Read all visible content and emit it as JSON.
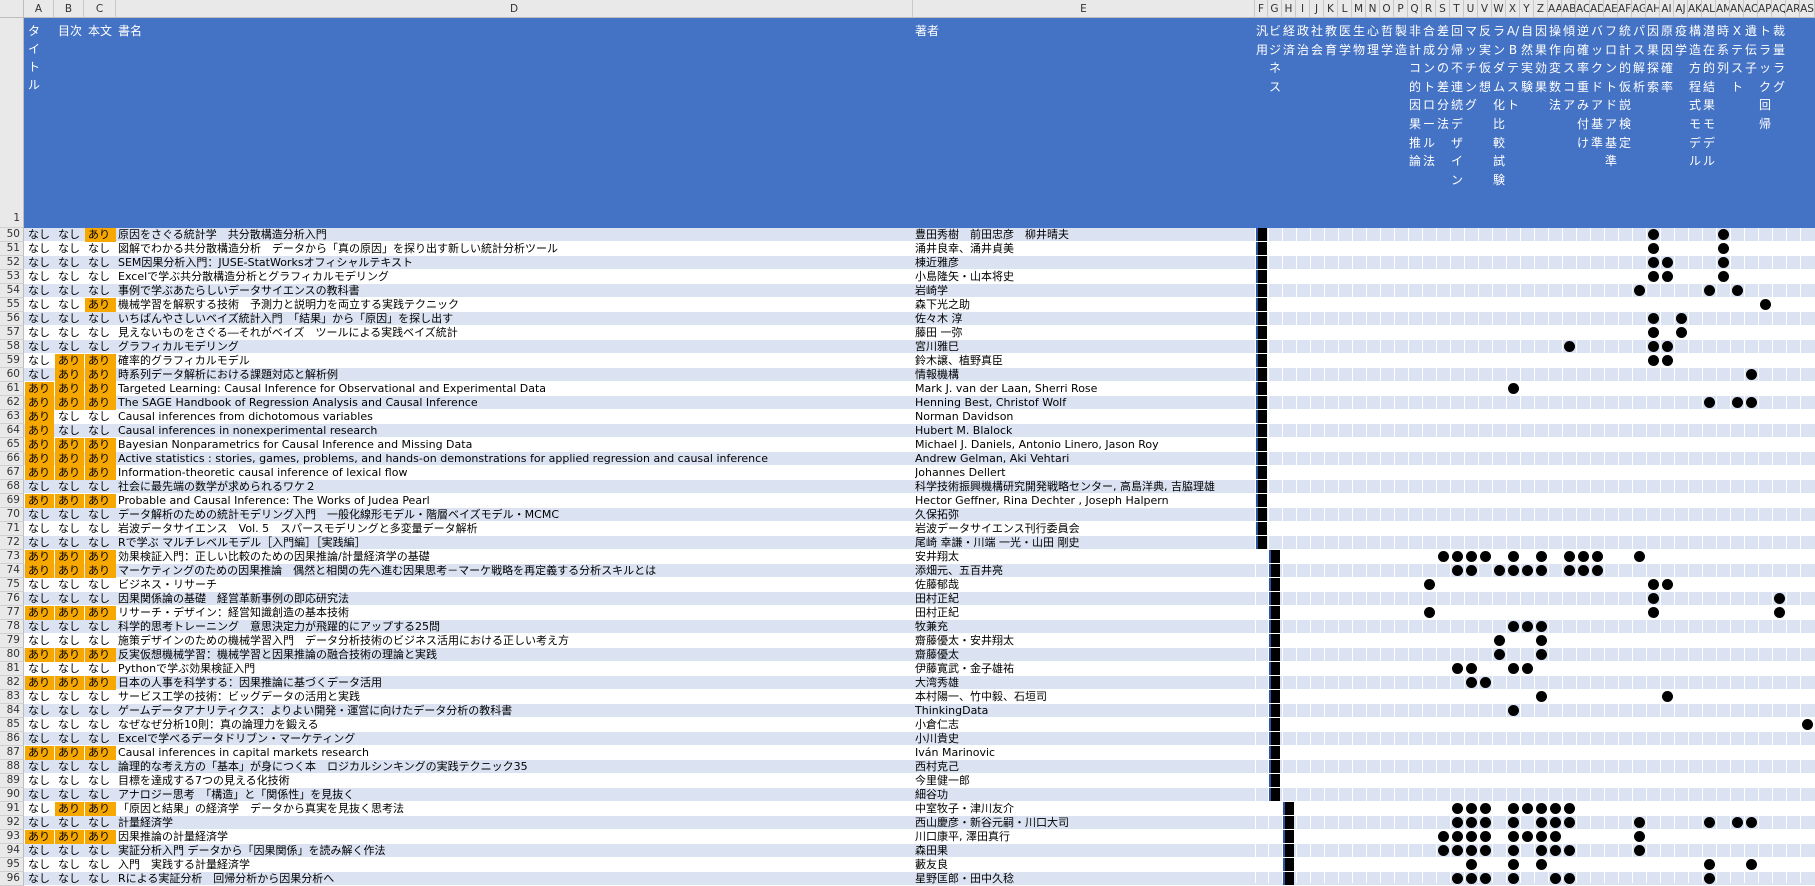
{
  "column_letters": [
    "A",
    "B",
    "C",
    "D",
    "E",
    "F",
    "G",
    "H",
    "I",
    "J",
    "K",
    "L",
    "M",
    "N",
    "O",
    "P",
    "Q",
    "R",
    "S",
    "T",
    "U",
    "V",
    "W",
    "X",
    "Y",
    "Z",
    "AA",
    "AB",
    "AC",
    "AD",
    "AE",
    "AF",
    "AG",
    "AH",
    "AI",
    "AJ",
    "AK",
    "AL",
    "AM",
    "AN",
    "AO",
    "AP",
    "AQ",
    "AR",
    "AS"
  ],
  "header_row_number": "1",
  "header": {
    "title_flag": "タイトル",
    "toc_flag": "目次",
    "body_flag": "本文",
    "book_title": "書名",
    "author": "著者",
    "topics": [
      "汎用",
      "ビジネス",
      "経済",
      "政治",
      "社会",
      "教育",
      "医学",
      "生物",
      "心理",
      "哲学",
      "製造",
      "非計コ的因果推論",
      "合成ントロール法",
      "差分の差分法",
      "回帰不連続デザイン",
      "マッチング",
      "反実仮想",
      "ランダム化比較試験",
      "A/Bテスト",
      "自然実験",
      "因果効果",
      "操作変数法",
      "傾向スコア",
      "逆確率重み付け",
      "バックドア基準",
      "フロントドア基準",
      "統計的仮説検定",
      "パス解析",
      "因果探索",
      "原因確率",
      "疫学",
      "構造方程式モデル",
      "潜在的結果モデル",
      "時系列",
      "Xテスト",
      "遺伝子",
      "トラック回帰",
      "裁量ラグ"
    ]
  },
  "rows": [
    {
      "n": "50",
      "a": "なし",
      "b": "なし",
      "c": "あり",
      "title": "原因をさぐる統計学　共分散構造分析入門",
      "author": "豊田秀樹　前田忠彦　柳井晴夫"
    },
    {
      "n": "51",
      "a": "なし",
      "b": "なし",
      "c": "なし",
      "title": "図解でわかる共分散構造分析　データから「真の原因」を探り出す新しい統計分析ツール",
      "author": "涌井良幸、涌井貞美"
    },
    {
      "n": "52",
      "a": "なし",
      "b": "なし",
      "c": "なし",
      "title": "SEM因果分析入門：JUSE-StatWorksオフィシャルテキスト",
      "author": "棟近雅彦"
    },
    {
      "n": "53",
      "a": "なし",
      "b": "なし",
      "c": "なし",
      "title": "Excelで学ぶ共分散構造分析とグラフィカルモデリング",
      "author": "小島隆矢・山本将史"
    },
    {
      "n": "54",
      "a": "なし",
      "b": "なし",
      "c": "なし",
      "title": "事例で学ぶあたらしいデータサイエンスの教科書",
      "author": "岩崎学"
    },
    {
      "n": "55",
      "a": "なし",
      "b": "なし",
      "c": "あり",
      "title": "機械学習を解釈する技術　予測力と説明力を両立する実践テクニック",
      "author": "森下光之助"
    },
    {
      "n": "56",
      "a": "なし",
      "b": "なし",
      "c": "なし",
      "title": "いちばんやさしいベイズ統計入門　「結果」から「原因」を探し出す",
      "author": "佐々木 淳"
    },
    {
      "n": "57",
      "a": "なし",
      "b": "なし",
      "c": "なし",
      "title": "見えないものをさぐる―それがベイズ　ツールによる実践ベイズ統計",
      "author": "藤田 一弥"
    },
    {
      "n": "58",
      "a": "なし",
      "b": "なし",
      "c": "なし",
      "title": "グラフィカルモデリング",
      "author": "宮川雅巳"
    },
    {
      "n": "59",
      "a": "なし",
      "b": "あり",
      "c": "あり",
      "title": "確率的グラフィカルモデル",
      "author": "鈴木譲、植野真臣"
    },
    {
      "n": "60",
      "a": "なし",
      "b": "あり",
      "c": "あり",
      "title": "時系列データ解析における課題対応と解析例",
      "author": "情報機構"
    },
    {
      "n": "61",
      "a": "あり",
      "b": "あり",
      "c": "あり",
      "title": "Targeted Learning: Causal Inference for Observational and Experimental Data",
      "author": "Mark J. van der Laan, Sherri Rose"
    },
    {
      "n": "62",
      "a": "あり",
      "b": "あり",
      "c": "あり",
      "title": "The SAGE Handbook of Regression Analysis and Causal Inference",
      "author": "Henning Best, Christof Wolf"
    },
    {
      "n": "63",
      "a": "あり",
      "b": "なし",
      "c": "なし",
      "title": "Causal inferences from dichotomous variables",
      "author": "Norman Davidson"
    },
    {
      "n": "64",
      "a": "あり",
      "b": "なし",
      "c": "なし",
      "title": "Causal inferences in nonexperimental research",
      "author": "Hubert M. Blalock"
    },
    {
      "n": "65",
      "a": "あり",
      "b": "あり",
      "c": "あり",
      "title": "Bayesian Nonparametrics for Causal Inference and Missing Data",
      "author": "Michael J. Daniels, Antonio Linero, Jason Roy"
    },
    {
      "n": "66",
      "a": "あり",
      "b": "あり",
      "c": "あり",
      "title": "Active statistics : stories, games, problems, and hands-on demonstrations for applied regression and causal inference",
      "author": "Andrew Gelman, Aki Vehtari"
    },
    {
      "n": "67",
      "a": "あり",
      "b": "あり",
      "c": "あり",
      "title": "Information-theoretic causal inference of lexical flow",
      "author": "Johannes Dellert"
    },
    {
      "n": "68",
      "a": "なし",
      "b": "なし",
      "c": "なし",
      "title": "社会に最先端の数学が求められるワケ２",
      "author": "科学技術振興機構研究開発戦略センター, 高島洋典, 吉脇理雄"
    },
    {
      "n": "69",
      "a": "あり",
      "b": "あり",
      "c": "あり",
      "title": "Probable and Causal Inference: The Works of Judea Pearl",
      "author": "Hector Geffner, Rina Dechter , Joseph Halpern"
    },
    {
      "n": "70",
      "a": "なし",
      "b": "なし",
      "c": "なし",
      "title": "データ解析のための統計モデリング入門　一般化線形モデル・階層ベイズモデル・MCMC",
      "author": "久保拓弥"
    },
    {
      "n": "71",
      "a": "なし",
      "b": "なし",
      "c": "なし",
      "title": "岩波データサイエンス　Vol. 5　スパースモデリングと多変量データ解析",
      "author": "岩波データサイエンス刊行委員会"
    },
    {
      "n": "72",
      "a": "なし",
      "b": "なし",
      "c": "なし",
      "title": "Rで学ぶ マルチレベルモデル［入門編］［実践編］",
      "author": "尾崎 幸謙・川端 一光・山田 剛史"
    },
    {
      "n": "73",
      "a": "あり",
      "b": "あり",
      "c": "あり",
      "title": "効果検証入門：正しい比較のための因果推論/計量経済学の基礎",
      "author": "安井翔太"
    },
    {
      "n": "74",
      "a": "あり",
      "b": "あり",
      "c": "あり",
      "title": "マーケティングのための因果推論　偶然と相関の先へ進む因果思考－マーケ戦略を再定義する分析スキルとは",
      "author": "添畑元、五百井亮"
    },
    {
      "n": "75",
      "a": "なし",
      "b": "なし",
      "c": "なし",
      "title": "ビジネス・リサーチ",
      "author": "佐藤郁哉"
    },
    {
      "n": "76",
      "a": "なし",
      "b": "なし",
      "c": "なし",
      "title": "因果関係論の基礎　経営革新事例の即応研究法",
      "author": "田村正紀"
    },
    {
      "n": "77",
      "a": "あり",
      "b": "あり",
      "c": "あり",
      "title": "リサーチ・デザイン：経営知識創造の基本技術",
      "author": "田村正紀"
    },
    {
      "n": "78",
      "a": "なし",
      "b": "なし",
      "c": "なし",
      "title": "科学的思考トレーニング　意思決定力が飛躍的にアップする25問",
      "author": "牧兼充"
    },
    {
      "n": "79",
      "a": "なし",
      "b": "なし",
      "c": "なし",
      "title": "施策デザインのための機械学習入門　データ分析技術のビジネス活用における正しい考え方",
      "author": "齋藤優太・安井翔太"
    },
    {
      "n": "80",
      "a": "あり",
      "b": "あり",
      "c": "あり",
      "title": "反実仮想機械学習：機械学習と因果推論の融合技術の理論と実践",
      "author": "齋藤優太"
    },
    {
      "n": "81",
      "a": "なし",
      "b": "なし",
      "c": "なし",
      "title": "Pythonで学ぶ効果検証入門",
      "author": "伊藤寛武・金子雄祐"
    },
    {
      "n": "82",
      "a": "あり",
      "b": "あり",
      "c": "あり",
      "title": "日本の人事を科学する：因果推論に基づくデータ活用",
      "author": "大湾秀雄"
    },
    {
      "n": "83",
      "a": "なし",
      "b": "なし",
      "c": "なし",
      "title": "サービス工学の技術：ビッグデータの活用と実践",
      "author": "本村陽一、竹中毅、石垣司"
    },
    {
      "n": "84",
      "a": "なし",
      "b": "なし",
      "c": "なし",
      "title": "ゲームデータアナリティクス：よりよい開発・運営に向けたデータ分析の教科書",
      "author": "ThinkingData"
    },
    {
      "n": "85",
      "a": "なし",
      "b": "なし",
      "c": "なし",
      "title": "なぜなぜ分析10則：真の論理力を鍛える",
      "author": "小倉仁志"
    },
    {
      "n": "86",
      "a": "なし",
      "b": "なし",
      "c": "なし",
      "title": "Excelで学べるデータドリブン・マーケティング",
      "author": "小川貴史"
    },
    {
      "n": "87",
      "a": "あり",
      "b": "あり",
      "c": "あり",
      "title": "Causal inferences in capital markets research",
      "author": "Iván Marinovic"
    },
    {
      "n": "88",
      "a": "なし",
      "b": "なし",
      "c": "なし",
      "title": "論理的な考え方の「基本」が身につく本　ロジカルシンキングの実践テクニック35",
      "author": "西村克己"
    },
    {
      "n": "89",
      "a": "なし",
      "b": "なし",
      "c": "なし",
      "title": "目標を達成する7つの見える化技術",
      "author": "今里健一郎"
    },
    {
      "n": "90",
      "a": "なし",
      "b": "なし",
      "c": "なし",
      "title": "アナロジー思考　「構造」と「関係性」を見抜く",
      "author": "細谷功"
    },
    {
      "n": "91",
      "a": "なし",
      "b": "あり",
      "c": "あり",
      "title": "「原因と結果」の経済学　データから真実を見抜く思考法",
      "author": "中室牧子・津川友介"
    },
    {
      "n": "92",
      "a": "なし",
      "b": "なし",
      "c": "なし",
      "title": "計量経済学",
      "author": "西山慶彦・新谷元嗣・川口大司"
    },
    {
      "n": "93",
      "a": "あり",
      "b": "あり",
      "c": "あり",
      "title": "因果推論の計量経済学",
      "author": "川口康平, 澤田真行"
    },
    {
      "n": "94",
      "a": "なし",
      "b": "なし",
      "c": "なし",
      "title": "実証分析入門 データから「因果関係」を読み解く作法",
      "author": "森田果"
    },
    {
      "n": "95",
      "a": "なし",
      "b": "なし",
      "c": "なし",
      "title": "入門　実践する計量経済学",
      "author": "藪友良"
    },
    {
      "n": "96",
      "a": "なし",
      "b": "なし",
      "c": "なし",
      "title": "Rによる実証分析　回帰分析から因果分析へ",
      "author": "星野匡郎・田中久稔"
    }
  ],
  "marks": {
    "50": [
      33,
      38
    ],
    "51": [
      33,
      38
    ],
    "52": [
      33,
      34,
      38
    ],
    "53": [
      33,
      34,
      38
    ],
    "54": [
      32,
      37,
      39
    ],
    "55": [
      41
    ],
    "56": [
      33,
      35
    ],
    "57": [
      33,
      35
    ],
    "58": [
      27,
      33,
      34
    ],
    "59": [
      33,
      34
    ],
    "60": [
      40
    ],
    "61": [
      23
    ],
    "62": [
      37,
      39,
      40
    ],
    "73": [
      18,
      19,
      20,
      21,
      23,
      25,
      27,
      28,
      29,
      32
    ],
    "74": [
      19,
      20,
      22,
      23,
      24,
      25,
      27,
      28,
      29
    ],
    "75": [
      17,
      33,
      34
    ],
    "76": [
      33,
      42
    ],
    "77": [
      17,
      33,
      42
    ],
    "78": [
      23,
      24,
      25
    ],
    "79": [
      22,
      25
    ],
    "80": [
      22,
      25
    ],
    "81": [
      19,
      20,
      23,
      24
    ],
    "82": [
      20,
      21
    ],
    "83": [
      25,
      34
    ],
    "84": [
      23
    ],
    "85": [
      44
    ],
    "91": [
      19,
      20,
      21,
      23,
      24,
      25,
      26,
      27
    ],
    "92": [
      19,
      20,
      21,
      23,
      25,
      26,
      27,
      32,
      37,
      39,
      40
    ],
    "93": [
      18,
      19,
      20,
      21,
      23,
      24,
      25,
      26,
      32
    ],
    "94": [
      18,
      19,
      20,
      21,
      23,
      25,
      26,
      27,
      32
    ],
    "95": [
      20,
      23,
      25,
      37,
      40
    ],
    "96": [
      19,
      20,
      21,
      23,
      26,
      27,
      37
    ]
  },
  "square_groups": [
    {
      "from": "50",
      "to": "72",
      "col": 5
    },
    {
      "from": "73",
      "to": "90",
      "col": 6
    },
    {
      "from": "91",
      "to": "96",
      "col": 7
    }
  ],
  "flag_colors": {
    "yes": "#f6a800",
    "header": "#4472c4",
    "band_a": "#dbe3f2",
    "band_b": "#ffffff"
  }
}
